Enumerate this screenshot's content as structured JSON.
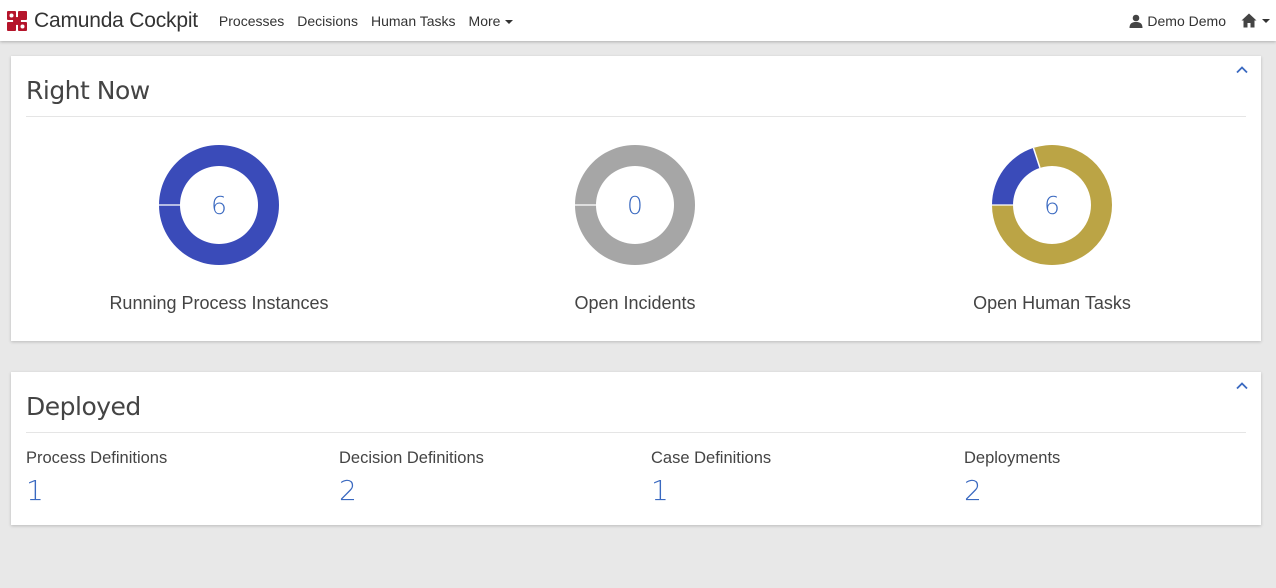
{
  "app": {
    "brand_name": "Camunda Cockpit",
    "logo_icon": "camunda-logo-icon",
    "brand_color": "#b5152b"
  },
  "nav": {
    "items": [
      {
        "label": "Processes"
      },
      {
        "label": "Decisions"
      },
      {
        "label": "Human Tasks"
      },
      {
        "label": "More"
      }
    ],
    "user_label": "Demo Demo",
    "user_icon": "user-icon",
    "home_icon": "home-icon"
  },
  "right_now": {
    "title": "Right Now",
    "collapse_icon": "chevron-up-icon",
    "donuts": [
      {
        "count": "6",
        "label": "Running Process Instances",
        "segments": [
          {
            "value": 6,
            "color": "#3a4bb9"
          }
        ]
      },
      {
        "count": "0",
        "label": "Open Incidents",
        "segments": [
          {
            "value": 1,
            "color": "#a6a6a6"
          }
        ]
      },
      {
        "count": "6",
        "label": "Open Human Tasks",
        "segments": [
          {
            "value": 1.2,
            "color": "#3a4bb9"
          },
          {
            "value": 4.8,
            "color": "#bba445"
          }
        ]
      }
    ]
  },
  "deployed": {
    "title": "Deployed",
    "collapse_icon": "chevron-up-icon",
    "stats": [
      {
        "label": "Process Definitions",
        "value": "1"
      },
      {
        "label": "Decision Definitions",
        "value": "2"
      },
      {
        "label": "Case Definitions",
        "value": "1"
      },
      {
        "label": "Deployments",
        "value": "2"
      }
    ]
  },
  "colors": {
    "link": "#3a69c0",
    "background": "#e8e8e8"
  }
}
